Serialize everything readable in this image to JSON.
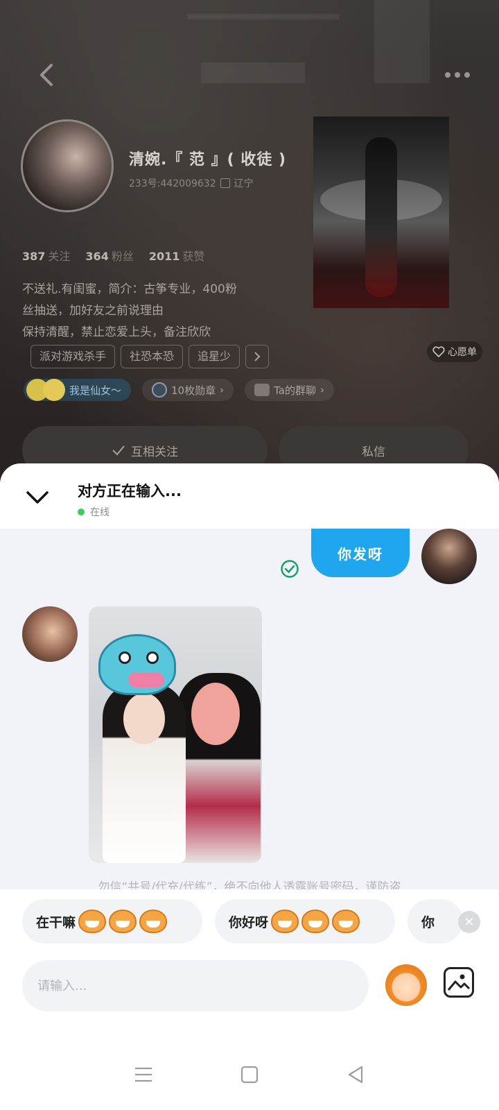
{
  "profile": {
    "nickname": "清婉.『 范 』( 收徒 )",
    "id_text": "233号:442009632",
    "location": "辽宁",
    "stats": [
      {
        "num": "387",
        "label": "关注"
      },
      {
        "num": "364",
        "label": "粉丝"
      },
      {
        "num": "2011",
        "label": "获赞"
      }
    ],
    "bio_lines": [
      "不送礼.有闺蜜，简介：古筝专业，400粉",
      "丝抽送，加好友之前说理由",
      "保持清醒，禁止恋爱上头，备注欣欣"
    ],
    "tags": [
      "派对游戏杀手",
      "社恐本恐",
      "追星少"
    ],
    "wishlist_label": "心愿单",
    "badges": {
      "fairy": "我是仙女～",
      "medals": "10枚勋章",
      "group_chat": "Ta的群聊"
    },
    "follow_button": "互相关注",
    "message_button": "私信"
  },
  "chat": {
    "title": "对方正在输入...",
    "status": "在线",
    "outgoing_message": "你发呀",
    "notice": "勿信“共号/代充/代练”，绝不向他人透露账号密码，谨防盗",
    "quick_replies": [
      "在干嘛",
      "你好呀",
      "你"
    ],
    "input_placeholder": "请输入..."
  },
  "colors": {
    "accent": "#1fa6ef",
    "online": "#3ccf55",
    "sheet_bg": "#f2f3f8"
  }
}
